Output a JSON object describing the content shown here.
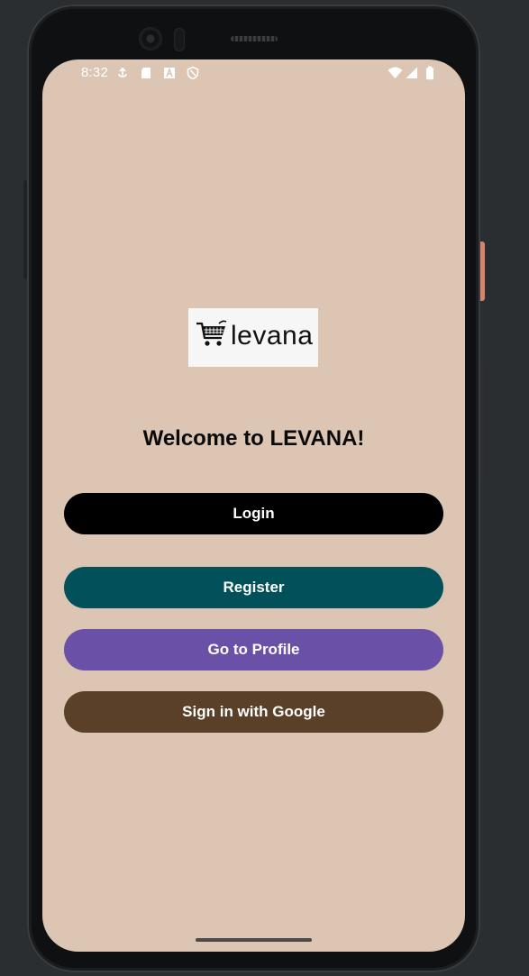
{
  "status_bar": {
    "time": "8:32",
    "left_icons": [
      "usb-debug-icon",
      "sd-card-icon",
      "font-a-icon",
      "shield-icon"
    ],
    "right_icons": [
      "wifi-icon",
      "cellular-signal-icon",
      "battery-icon"
    ]
  },
  "logo": {
    "text": "levana",
    "icon": "shopping-cart-icon"
  },
  "welcome": {
    "title": "Welcome to LEVANA!"
  },
  "buttons": {
    "login": {
      "label": "Login",
      "color": "#000000"
    },
    "register": {
      "label": "Register",
      "color": "#02515a"
    },
    "profile": {
      "label": "Go to Profile",
      "color": "#6a50a7"
    },
    "google": {
      "label": "Sign in with Google",
      "color": "#5a4028"
    }
  },
  "theme": {
    "screen_background": "#dcc6b3",
    "text_color": "#ffffff"
  }
}
